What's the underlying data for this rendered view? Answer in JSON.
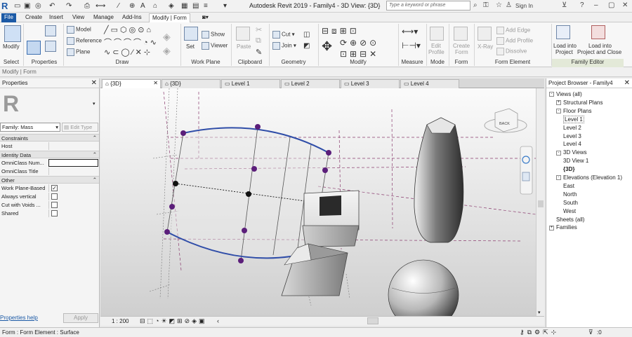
{
  "app": {
    "title": "Autodesk Revit 2019 - Family4 - 3D View: {3D}",
    "search_placeholder": "Type a keyword or phrase",
    "sign_in": "Sign In"
  },
  "menu_tabs": [
    "File",
    "Create",
    "Insert",
    "View",
    "Manage",
    "Add-Ins",
    "Modify | Form"
  ],
  "ribbon": {
    "panels": {
      "select": "Select",
      "properties": "Properties",
      "draw": "Draw",
      "work_plane": "Work Plane",
      "clipboard": "Clipboard",
      "geometry": "Geometry",
      "modify": "Modify",
      "measure": "Measure",
      "mode": "Mode",
      "form": "Form",
      "form_element": "Form Element",
      "family_editor": "Family Editor"
    },
    "buttons": {
      "modify": "Modify",
      "model": "Model",
      "reference": "Reference",
      "plane": "Plane",
      "set": "Set",
      "show": "Show",
      "viewer": "Viewer",
      "paste": "Paste",
      "cut": "Cut",
      "join": "Join",
      "edit_profile_1": "Edit",
      "edit_profile_2": "Profile",
      "create_form_1": "Create",
      "create_form_2": "Form",
      "xray": "X-Ray",
      "add_edge": "Add Edge",
      "add_profile": "Add Profile",
      "dissolve": "Dissolve",
      "load_project_1": "Load into",
      "load_project_2": "Project",
      "load_close_1": "Load into",
      "load_close_2": "Project and Close"
    }
  },
  "context_bar": "Modify | Form",
  "properties": {
    "title": "Properties",
    "family_type": "Family: Mass",
    "edit_type": "Edit Type",
    "sections": {
      "constraints": "Constraints",
      "identity": "Identity Data",
      "other": "Other"
    },
    "rows": {
      "host": "Host",
      "omniclass_number": "OmniClass Num...",
      "omniclass_title": "OmniClass Title",
      "work_plane_based": "Work Plane-Based",
      "always_vertical": "Always vertical",
      "cut_with_voids": "Cut with Voids ...",
      "shared": "Shared"
    },
    "checkbox_states": {
      "work_plane_based": true,
      "always_vertical": false,
      "cut_with_voids": false,
      "shared": false
    },
    "help": "Properties help",
    "apply": "Apply"
  },
  "view_tabs": [
    "{3D}",
    "{3D}",
    "Level 1",
    "Level 2",
    "Level 3",
    "Level 4"
  ],
  "view_cube_label": "BACK",
  "view_scale": "1 : 200",
  "browser": {
    "title": "Project Browser - Family4",
    "items": [
      {
        "label": "Views (all)",
        "level": 0,
        "toggle": "-"
      },
      {
        "label": "Structural Plans",
        "level": 1,
        "toggle": "+"
      },
      {
        "label": "Floor Plans",
        "level": 1,
        "toggle": "-"
      },
      {
        "label": "Level 1",
        "level": 2,
        "toggle": "",
        "active": true
      },
      {
        "label": "Level 2",
        "level": 2,
        "toggle": ""
      },
      {
        "label": "Level 3",
        "level": 2,
        "toggle": ""
      },
      {
        "label": "Level 4",
        "level": 2,
        "toggle": ""
      },
      {
        "label": "3D Views",
        "level": 1,
        "toggle": "-"
      },
      {
        "label": "3D View 1",
        "level": 2,
        "toggle": ""
      },
      {
        "label": "{3D}",
        "level": 2,
        "toggle": "",
        "bold": true
      },
      {
        "label": "Elevations (Elevation 1)",
        "level": 1,
        "toggle": "-"
      },
      {
        "label": "East",
        "level": 2,
        "toggle": ""
      },
      {
        "label": "North",
        "level": 2,
        "toggle": ""
      },
      {
        "label": "South",
        "level": 2,
        "toggle": ""
      },
      {
        "label": "West",
        "level": 2,
        "toggle": ""
      },
      {
        "label": "Sheets (all)",
        "level": 0,
        "toggle": ""
      },
      {
        "label": "Families",
        "level": 0,
        "toggle": "+"
      }
    ]
  },
  "status": {
    "text": "Form : Form Element : Surface",
    "filter_count": ":0"
  },
  "colors": {
    "file_tab": "#1c5aa6",
    "form_curve": "#2f4da8",
    "control_point": "#5b1e7a",
    "family_editor_panel": "#e3e9d8"
  }
}
